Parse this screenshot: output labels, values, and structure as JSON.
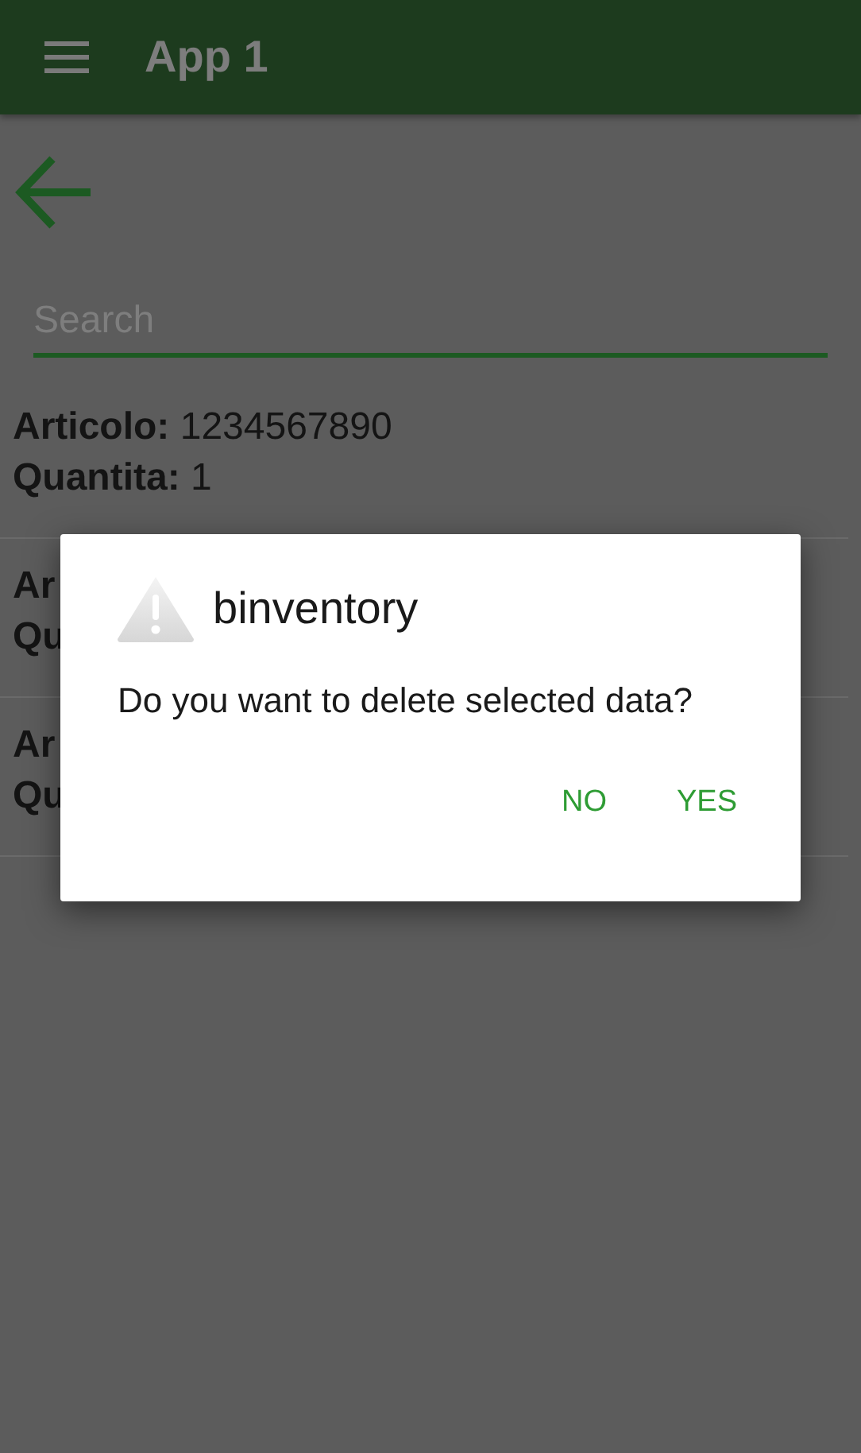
{
  "app_bar": {
    "title": "App 1"
  },
  "search": {
    "placeholder": "Search"
  },
  "rows": [
    {
      "lines": [
        {
          "label": "Articolo:",
          "value": "1234567890"
        },
        {
          "label": "Quantita:",
          "value": "1"
        }
      ]
    },
    {
      "lines": [
        {
          "label": "Ar"
        },
        {
          "label": "Qu"
        }
      ]
    },
    {
      "lines": [
        {
          "label": "Ar"
        },
        {
          "label": "Qu"
        }
      ]
    }
  ],
  "dialog": {
    "title": "binventory",
    "message": "Do you want to delete selected data?",
    "buttons": [
      "NO",
      "YES"
    ]
  }
}
